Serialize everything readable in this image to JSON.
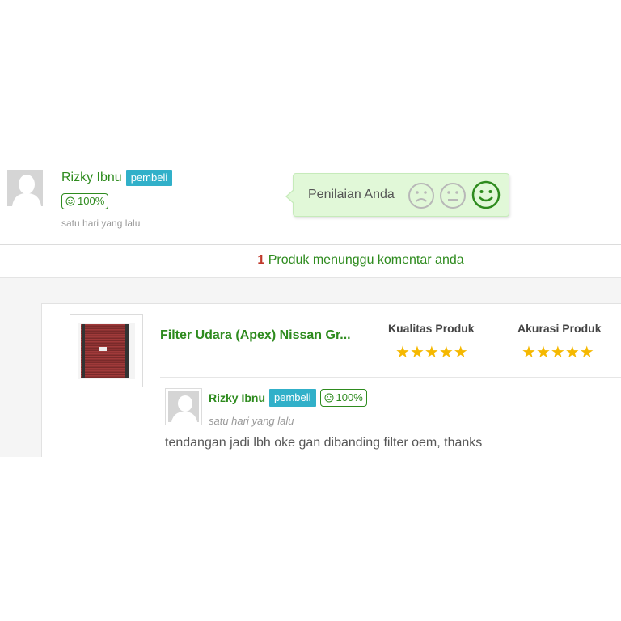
{
  "review": {
    "user_name": "Rizky Ibnu",
    "role_badge": "pembeli",
    "reputation": "100%",
    "time": "satu hari yang lalu",
    "rating_prompt": "Penilaian Anda",
    "rating_icons": [
      "sad-face-icon",
      "neutral-face-icon",
      "happy-face-icon"
    ],
    "selected_rating": "happy"
  },
  "pending": {
    "count": "1",
    "text": "Produk menunggu komentar anda"
  },
  "product": {
    "title": "Filter Udara (Apex) Nissan Gr...",
    "quality_label": "Kualitas Produk",
    "quality_stars": 5,
    "accuracy_label": "Akurasi Produk",
    "accuracy_stars": 5
  },
  "comment": {
    "user_name": "Rizky Ibnu",
    "role_badge": "pembeli",
    "reputation": "100%",
    "time": "satu hari yang lalu",
    "text": "tendangan jadi lbh oke gan dibanding filter oem, thanks"
  },
  "colors": {
    "brand_green": "#2e8b1e",
    "badge_blue": "#31b0c9",
    "star_gold": "#f5b800",
    "count_red": "#c0392b"
  }
}
